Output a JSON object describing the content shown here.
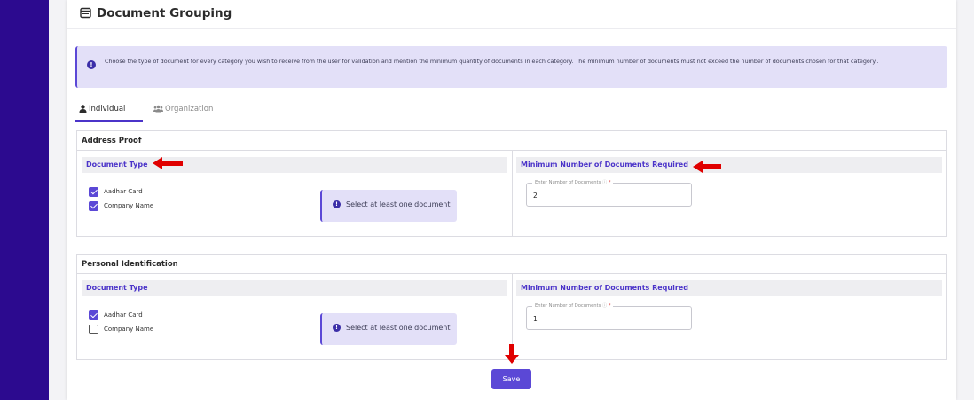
{
  "page": {
    "title": "Document Grouping",
    "info_text": "Choose the type of document for every category you wish to receive from the user for validation and mention the minimum quantity of documents in each category. The minimum number of documents must not exceed the number of documents chosen for that category..",
    "icons": {
      "title": "folder-window-icon",
      "info": "info-circle-icon",
      "tab_individual": "user-icon",
      "tab_organization": "users-group-icon",
      "arrow": "red-arrow-icon"
    }
  },
  "tabs": [
    {
      "label": "Individual",
      "active": true
    },
    {
      "label": "Organization",
      "active": false
    }
  ],
  "sections": [
    {
      "title": "Address Proof",
      "doc_type_label": "Document Type",
      "min_label": "Minimum Number of Documents Required",
      "documents": [
        {
          "label": "Aadhar Card",
          "checked": true
        },
        {
          "label": "Company Name",
          "checked": true
        }
      ],
      "warning": "Select at least one document",
      "field_label": "Enter Number of Documents",
      "field_value": "2"
    },
    {
      "title": "Personal Identification",
      "doc_type_label": "Document Type",
      "min_label": "Minimum Number of Documents Required",
      "documents": [
        {
          "label": "Aadhar Card",
          "checked": true
        },
        {
          "label": "Company Name",
          "checked": false
        }
      ],
      "warning": "Select at least one document",
      "field_label": "Enter Number of Documents",
      "field_value": "1"
    }
  ],
  "actions": {
    "save_label": "Save"
  },
  "colors": {
    "sidebar": "#2c0a8f",
    "accent": "#5b48d6",
    "banner": "#e3e0f8",
    "arrow": "#e00000"
  }
}
